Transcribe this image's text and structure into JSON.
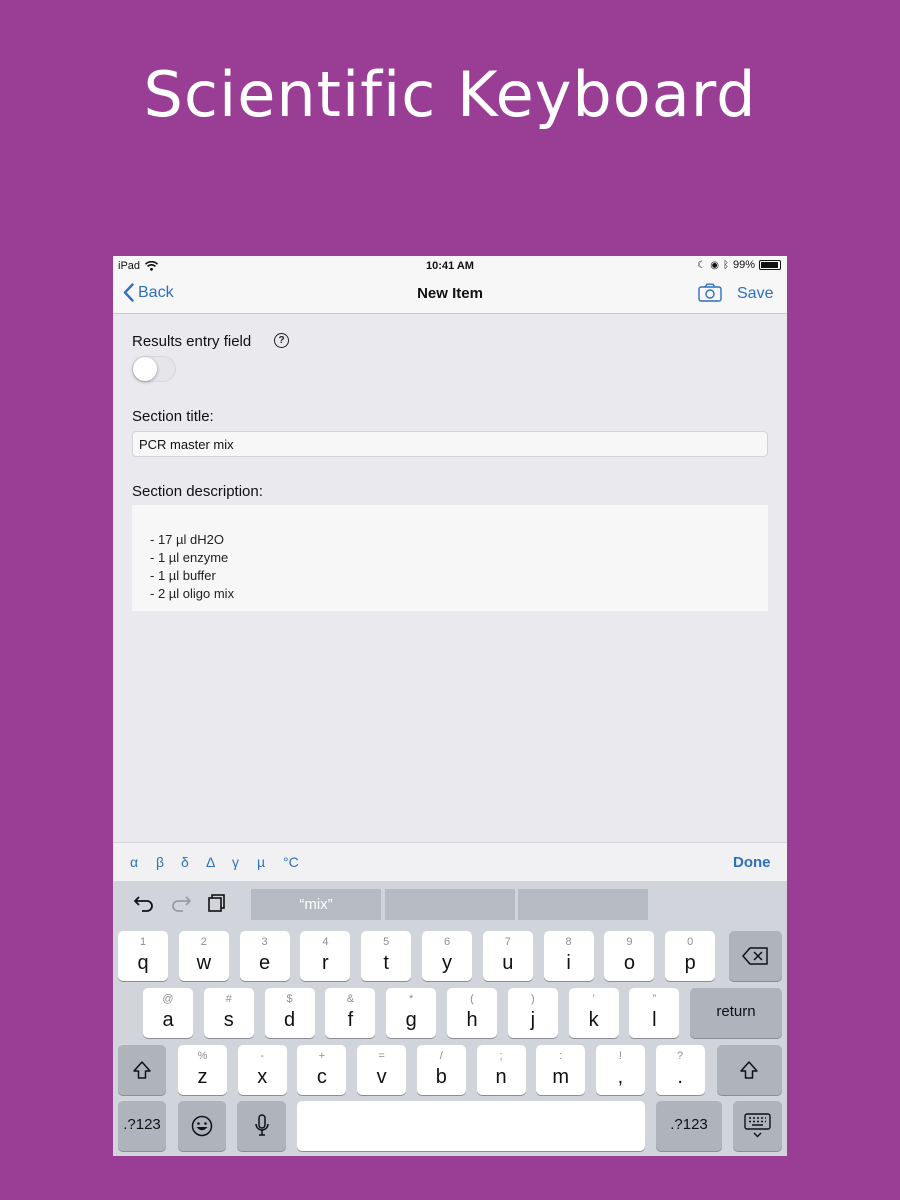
{
  "headline": "Scientific Keyboard",
  "status_bar": {
    "device": "iPad",
    "time": "10:41 AM",
    "battery": "99%"
  },
  "nav": {
    "back_label": "Back",
    "title": "New Item",
    "save_label": "Save"
  },
  "form": {
    "results_label": "Results entry field",
    "results_toggle_on": false,
    "help_glyph": "?",
    "section_title_label": "Section title:",
    "section_title_value": "PCR master mix",
    "section_description_label": "Section description:",
    "description_lines": [
      "- 17 µl dH2O",
      "- 1 µl enzyme",
      "- 1 µl buffer",
      "- 2 µl oligo mix"
    ]
  },
  "symbol_bar": {
    "symbols": [
      "α",
      "β",
      "δ",
      "Δ",
      "γ",
      "µ",
      "°C"
    ],
    "done_label": "Done"
  },
  "keyboard": {
    "suggestions": [
      "“mix”",
      "",
      ""
    ],
    "row1": [
      {
        "sub": "1",
        "main": "q"
      },
      {
        "sub": "2",
        "main": "w"
      },
      {
        "sub": "3",
        "main": "e"
      },
      {
        "sub": "4",
        "main": "r"
      },
      {
        "sub": "5",
        "main": "t"
      },
      {
        "sub": "6",
        "main": "y"
      },
      {
        "sub": "7",
        "main": "u"
      },
      {
        "sub": "8",
        "main": "i"
      },
      {
        "sub": "9",
        "main": "o"
      },
      {
        "sub": "0",
        "main": "p"
      }
    ],
    "row2": [
      {
        "sub": "@",
        "main": "a"
      },
      {
        "sub": "#",
        "main": "s"
      },
      {
        "sub": "$",
        "main": "d"
      },
      {
        "sub": "&",
        "main": "f"
      },
      {
        "sub": "*",
        "main": "g"
      },
      {
        "sub": "(",
        "main": "h"
      },
      {
        "sub": ")",
        "main": "j"
      },
      {
        "sub": "’",
        "main": "k"
      },
      {
        "sub": "”",
        "main": "l"
      }
    ],
    "row3": [
      {
        "sub": "%",
        "main": "z"
      },
      {
        "sub": "-",
        "main": "x"
      },
      {
        "sub": "+",
        "main": "c"
      },
      {
        "sub": "=",
        "main": "v"
      },
      {
        "sub": "/",
        "main": "b"
      },
      {
        "sub": ";",
        "main": "n"
      },
      {
        "sub": ":",
        "main": "m"
      },
      {
        "sub": "!",
        "main": ","
      },
      {
        "sub": "?",
        "main": "."
      }
    ],
    "return_label": "return",
    "numbers_label": ".?123"
  },
  "colors": {
    "background": "#9a3d94",
    "accent": "#2f6fbf"
  },
  "icons": [
    "wifi-icon",
    "chevron-left-icon",
    "camera-icon",
    "help-icon",
    "undo-icon",
    "redo-icon",
    "paste-icon",
    "backspace-icon",
    "shift-icon",
    "emoji-icon",
    "microphone-icon",
    "keyboard-dismiss-icon"
  ]
}
